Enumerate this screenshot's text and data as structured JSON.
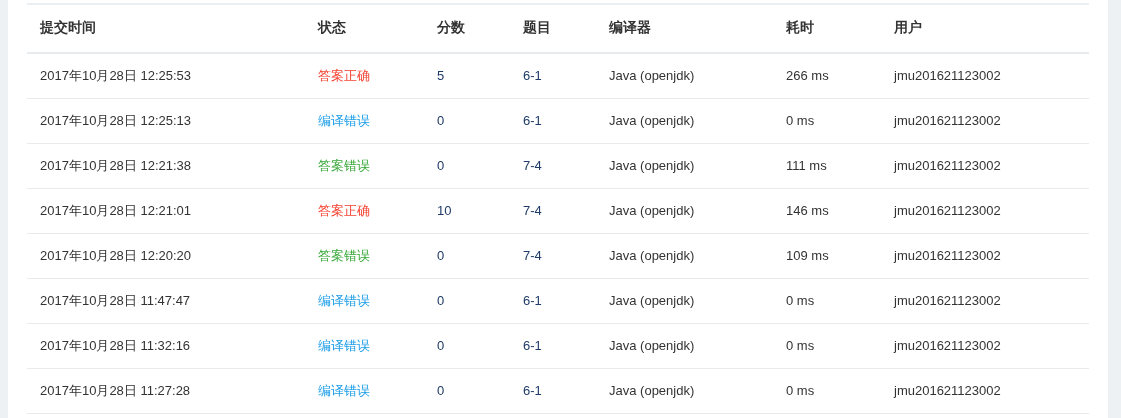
{
  "table": {
    "columns": [
      "提交时间",
      "状态",
      "分数",
      "题目",
      "编译器",
      "耗时",
      "用户"
    ],
    "rows": [
      {
        "time": "2017年10月28日 12:25:53",
        "status": {
          "text": "答案正确",
          "color": "#f5412f"
        },
        "score": "5",
        "problem": "6-1",
        "compiler": "Java (openjdk)",
        "duration": "266 ms",
        "user": "jmu201621123002"
      },
      {
        "time": "2017年10月28日 12:25:13",
        "status": {
          "text": "编译错误",
          "color": "#1e9ee8"
        },
        "score": "0",
        "problem": "6-1",
        "compiler": "Java (openjdk)",
        "duration": "0 ms",
        "user": "jmu201621123002"
      },
      {
        "time": "2017年10月28日 12:21:38",
        "status": {
          "text": "答案错误",
          "color": "#3aa83a"
        },
        "score": "0",
        "problem": "7-4",
        "compiler": "Java (openjdk)",
        "duration": "111 ms",
        "user": "jmu201621123002"
      },
      {
        "time": "2017年10月28日 12:21:01",
        "status": {
          "text": "答案正确",
          "color": "#f5412f"
        },
        "score": "10",
        "problem": "7-4",
        "compiler": "Java (openjdk)",
        "duration": "146 ms",
        "user": "jmu201621123002"
      },
      {
        "time": "2017年10月28日 12:20:20",
        "status": {
          "text": "答案错误",
          "color": "#3aa83a"
        },
        "score": "0",
        "problem": "7-4",
        "compiler": "Java (openjdk)",
        "duration": "109 ms",
        "user": "jmu201621123002"
      },
      {
        "time": "2017年10月28日 11:47:47",
        "status": {
          "text": "编译错误",
          "color": "#1e9ee8"
        },
        "score": "0",
        "problem": "6-1",
        "compiler": "Java (openjdk)",
        "duration": "0 ms",
        "user": "jmu201621123002"
      },
      {
        "time": "2017年10月28日 11:32:16",
        "status": {
          "text": "编译错误",
          "color": "#1e9ee8"
        },
        "score": "0",
        "problem": "6-1",
        "compiler": "Java (openjdk)",
        "duration": "0 ms",
        "user": "jmu201621123002"
      },
      {
        "time": "2017年10月28日 11:27:28",
        "status": {
          "text": "编译错误",
          "color": "#1e9ee8"
        },
        "score": "0",
        "problem": "6-1",
        "compiler": "Java (openjdk)",
        "duration": "0 ms",
        "user": "jmu201621123002"
      }
    ]
  }
}
